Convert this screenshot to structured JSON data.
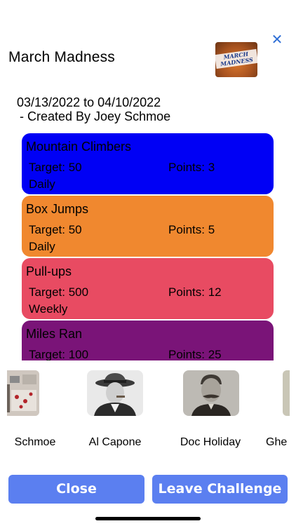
{
  "header": {
    "title": "March Madness",
    "close_glyph": "✕",
    "logo_text": "MARCH MADNESS"
  },
  "challenge": {
    "dates": "03/13/2022 to 04/10/2022",
    "creator": " - Created By Joey Schmoe"
  },
  "goals": [
    {
      "name": "Mountain Climbers",
      "target": "Target: 50",
      "points": "Points: 3",
      "frequency": "Daily",
      "color": "#0000f5"
    },
    {
      "name": "Box Jumps",
      "target": "Target: 50",
      "points": "Points: 5",
      "frequency": "Daily",
      "color": "#f0882f"
    },
    {
      "name": "Pull-ups",
      "target": "Target: 500",
      "points": "Points: 12",
      "frequency": "Weekly",
      "color": "#e84b62"
    },
    {
      "name": "Miles Ran",
      "target": "Target: 100",
      "points": "Points: 25",
      "frequency": "",
      "color": "#7a1478"
    }
  ],
  "members": [
    {
      "name": "Schmoe"
    },
    {
      "name": "Al Capone"
    },
    {
      "name": "Doc Holiday"
    },
    {
      "name": "Ghe"
    }
  ],
  "buttons": {
    "close": "Close",
    "leave": "Leave Challenge"
  }
}
